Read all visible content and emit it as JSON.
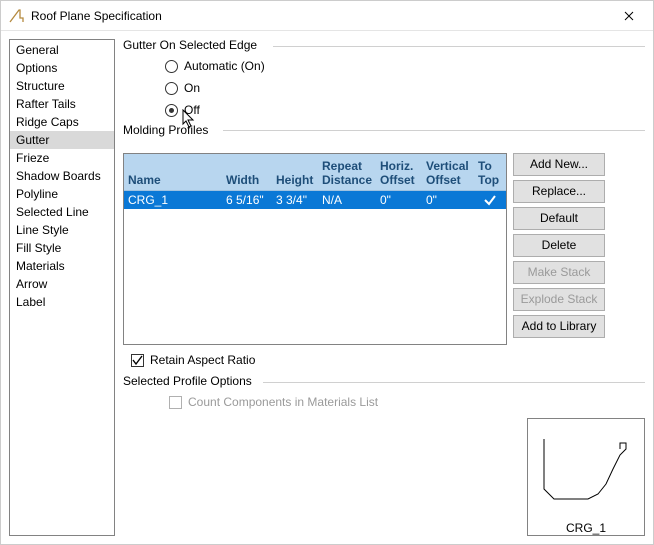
{
  "window": {
    "title": "Roof Plane Specification"
  },
  "sidebar": {
    "items": [
      {
        "label": "General"
      },
      {
        "label": "Options"
      },
      {
        "label": "Structure"
      },
      {
        "label": "Rafter Tails"
      },
      {
        "label": "Ridge Caps"
      },
      {
        "label": "Gutter",
        "selected": true
      },
      {
        "label": "Frieze"
      },
      {
        "label": "Shadow Boards"
      },
      {
        "label": "Polyline"
      },
      {
        "label": "Selected Line"
      },
      {
        "label": "Line Style"
      },
      {
        "label": "Fill Style"
      },
      {
        "label": "Materials"
      },
      {
        "label": "Arrow"
      },
      {
        "label": "Label"
      }
    ]
  },
  "groups": {
    "gutter_edge": "Gutter On Selected Edge",
    "molding": "Molding Profiles",
    "spo": "Selected Profile Options"
  },
  "radio": {
    "automatic": "Automatic (On)",
    "on": "On",
    "off": "Off",
    "selected": "off"
  },
  "table": {
    "headers": {
      "name": "Name",
      "width": "Width",
      "height": "Height",
      "repeat": "Repeat Distance",
      "horiz": "Horiz. Offset",
      "vert": "Vertical Offset",
      "totop": "To Top"
    },
    "rows": [
      {
        "name": "CRG_1",
        "width": "6 5/16\"",
        "height": "3 3/4\"",
        "repeat": "N/A",
        "horiz": "0\"",
        "vert": "0\"",
        "totop": true
      }
    ]
  },
  "buttons": {
    "add_new": "Add New...",
    "replace": "Replace...",
    "default": "Default",
    "delete": "Delete",
    "make_stack": "Make Stack",
    "explode_stack": "Explode Stack",
    "add_library": "Add to Library"
  },
  "retain": {
    "label": "Retain Aspect Ratio",
    "checked": true
  },
  "spo": {
    "count_components": "Count Components in Materials List",
    "checked": false,
    "enabled": false
  },
  "preview": {
    "label": "CRG_1"
  }
}
